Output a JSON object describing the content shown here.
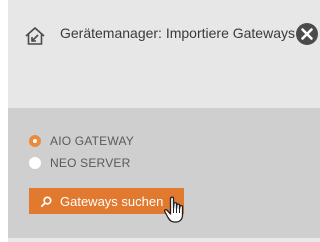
{
  "dialog": {
    "title": "Gerätemanager: Importiere Gateways",
    "icons": {
      "home": "house-icon",
      "close": "close-icon"
    }
  },
  "options": [
    {
      "label": "AIO GATEWAY",
      "selected": true
    },
    {
      "label": "NEO SERVER",
      "selected": false
    }
  ],
  "search_button": {
    "label": "Gateways suchen",
    "icon": "search-icon"
  },
  "colors": {
    "accent": "#e1792f",
    "radio_selected": "#e98a3e",
    "header_bg": "#e7e7e7",
    "panel_bg": "#cfcfcf"
  }
}
